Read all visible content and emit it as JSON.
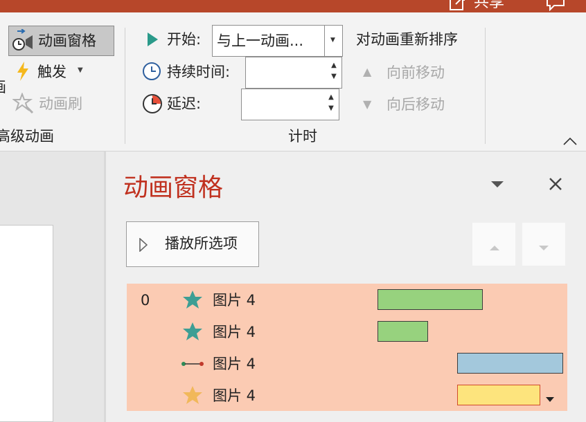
{
  "titlebar": {
    "share_icon": "share-icon",
    "share_label": "共享",
    "comment_icon": "comment-icon"
  },
  "ribbon": {
    "advanced_group": {
      "animation_pane_label": "动画窗格",
      "trigger_label": "触发",
      "animation_painter_label": "动画刷",
      "group_label": "高级动画",
      "left_cut_char": "画"
    },
    "timing_group": {
      "start_label": "开始:",
      "start_value": "与上一动画...",
      "duration_label": "持续时间:",
      "duration_value": "",
      "delay_label": "延迟:",
      "delay_value": "",
      "group_label": "计时"
    },
    "reorder_group": {
      "title": "对动画重新排序",
      "move_earlier_label": "向前移动",
      "move_later_label": "向后移动"
    }
  },
  "animation_pane": {
    "title": "动画窗格",
    "play_button_label": "播放所选项",
    "items": [
      {
        "index": "0",
        "icon": "green-star-icon",
        "label": "图片 4"
      },
      {
        "index": "",
        "icon": "green-star-icon",
        "label": "图片 4"
      },
      {
        "index": "",
        "icon": "motion-path-icon",
        "label": "图片 4"
      },
      {
        "index": "",
        "icon": "gold-star-icon",
        "label": "图片 4"
      }
    ]
  },
  "colors": {
    "titlebar": "#b7472a",
    "pane_title": "#c0311f",
    "list_bg": "#fbcbb3",
    "entrance_bar": "#97d27e",
    "motion_bar": "#a3c8dc",
    "emphasis_bar": "#fde47d",
    "green_star": "#3d9e94",
    "gold_star": "#f1b85a"
  }
}
